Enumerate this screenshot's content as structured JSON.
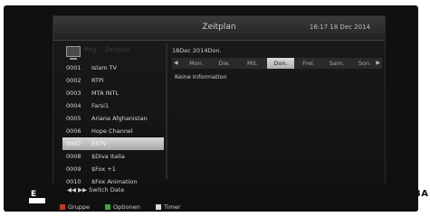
{
  "header": {
    "title": "Zeitplan",
    "clock": "16:17 18 Dec 2014"
  },
  "left_head": {
    "label": "Reg. - Zeitplan"
  },
  "channels": [
    {
      "num": "0001",
      "name": "Islam TV"
    },
    {
      "num": "0002",
      "name": "RTPi"
    },
    {
      "num": "0003",
      "name": "MTA INTL"
    },
    {
      "num": "0004",
      "name": "Farsi1"
    },
    {
      "num": "0005",
      "name": "Ariana Afghanistan"
    },
    {
      "num": "0006",
      "name": "Hope Channel"
    },
    {
      "num": "0007",
      "name": "ESTV"
    },
    {
      "num": "0008",
      "name": "$Diva Italia"
    },
    {
      "num": "0009",
      "name": "$Fox +1"
    },
    {
      "num": "0010",
      "name": "$Fox Animation"
    }
  ],
  "selected_channel": "0007",
  "epg": {
    "date": "18Dec 2014Don.",
    "days": [
      "Mon.",
      "Die.",
      "Mit.",
      "Don.",
      "Frei.",
      "Sam.",
      "Son."
    ],
    "active_day": "Don.",
    "info": "Keine Information"
  },
  "footer": {
    "switch_date": "Switch Date",
    "gruppe": "Gruppe",
    "optionen": "Optionen",
    "timer": "Timer",
    "gruppe_color": "#c23a2a",
    "optionen_color": "#3aa640",
    "timer_color": "#d9d9d9"
  },
  "overlay": {
    "logo_letter": "E",
    "watermark": "TABABA"
  }
}
